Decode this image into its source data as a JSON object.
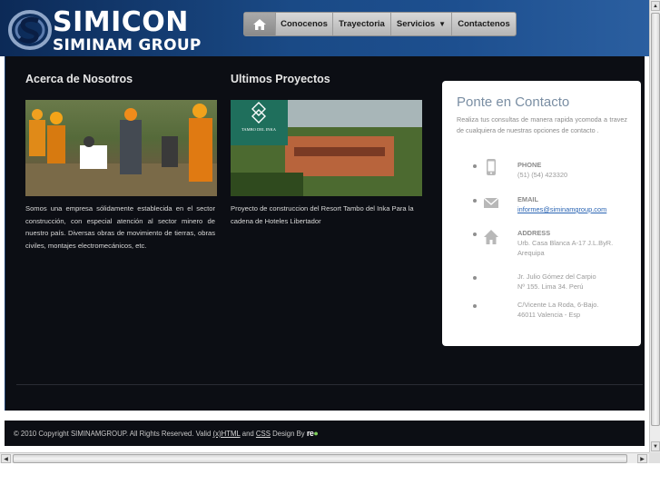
{
  "header": {
    "logo_title": "SIMICON",
    "logo_subtitle": "SIMINAM GROUP",
    "brand_color": "#1a4a86"
  },
  "nav": {
    "home_icon": "home-icon",
    "items": [
      {
        "label": "Conocenos"
      },
      {
        "label": "Trayectoria"
      },
      {
        "label": "Servicios"
      },
      {
        "label": "Contactenos"
      }
    ]
  },
  "about": {
    "title": "Acerca de Nosotros",
    "text": "Somos una empresa sólidamente establecida en el sector construcción, con especial atención al sector minero de nuestro país. Diversas obras de movimiento de tierras, obras civiles, montajes electromecánicos, etc."
  },
  "projects": {
    "title": "Ultimos Proyectos",
    "sign_text": "TAMBO DEL INKA",
    "text": "Proyecto de construccion del Resort Tambo del Inka Para la cadena de Hoteles Libertador"
  },
  "contact": {
    "title": "Ponte en Contacto",
    "intro": "Realiza tus consultas de manera rapida ycomoda a travez de cualquiera de nuestras opciones de contacto .",
    "phone_label": "PHONE",
    "phone_value": "(51) (54) 423320",
    "email_label": "EMAIL",
    "email_value": "informes@siminamgroup.com",
    "address_label": "ADDRESS",
    "address_line1": "Urb. Casa Blanca A-17 J.L.ByR.",
    "address_line2": "Arequipa",
    "address2_line1": "Jr. Julio Gómez del Carpio",
    "address2_line2": "Nº 155. Lima 34. Perú",
    "address3_line1": "C/Vicente La Roda, 6-Bajo.",
    "address3_line2": "46011 Valencia - Esp"
  },
  "footer": {
    "copyright": "© 2010 Copyright SIMINAMGROUP. All Rights Reserved. Valid",
    "xhtml": "(x)HTML",
    "and": "and",
    "css": "CSS",
    "design_by": "Design By",
    "logo": "re"
  }
}
